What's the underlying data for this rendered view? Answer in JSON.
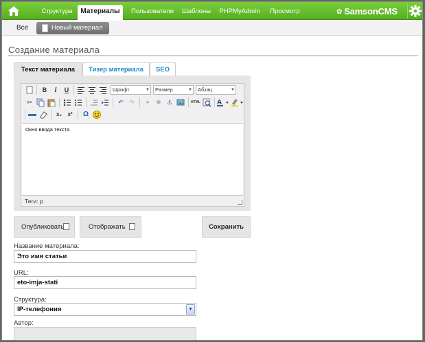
{
  "nav": {
    "items": [
      {
        "label": "Структура"
      },
      {
        "label": "Материалы"
      },
      {
        "label": "Пользователи"
      },
      {
        "label": "Шаблоны"
      },
      {
        "label": "PHPMyAdmin"
      },
      {
        "label": "Просмотр"
      }
    ],
    "active": "Материалы",
    "brand": "SamsonCMS",
    "home_icon": "home-icon",
    "gear_icon": "gear-icon"
  },
  "subnav": {
    "all_label": "Все",
    "new_label": "Новый материал"
  },
  "page": {
    "title": "Создание материала"
  },
  "tabs": [
    {
      "label": "Текст материала",
      "active": true
    },
    {
      "label": "Тизер материала",
      "active": false
    },
    {
      "label": "SEO",
      "active": false
    }
  ],
  "editor": {
    "font_dropdown": "Шрифт",
    "size_dropdown": "Размер",
    "format_dropdown": "Абзац",
    "content": "Окно ввода текста",
    "status": "Теги: p"
  },
  "actions": {
    "publish_label": "Опубликовать",
    "show_label": "Отображать",
    "save_label": "Сохранить"
  },
  "form": {
    "name_label": "Название материала:",
    "name_value": "Это имя статьи",
    "url_label": "URL:",
    "url_value": "eto-imja-stati",
    "structure_label": "Структура:",
    "structure_value": "IP-телефония",
    "author_label": "Автор:"
  },
  "colors": {
    "nav_green": "#5dbb2a",
    "link_blue": "#1b8bc7"
  }
}
